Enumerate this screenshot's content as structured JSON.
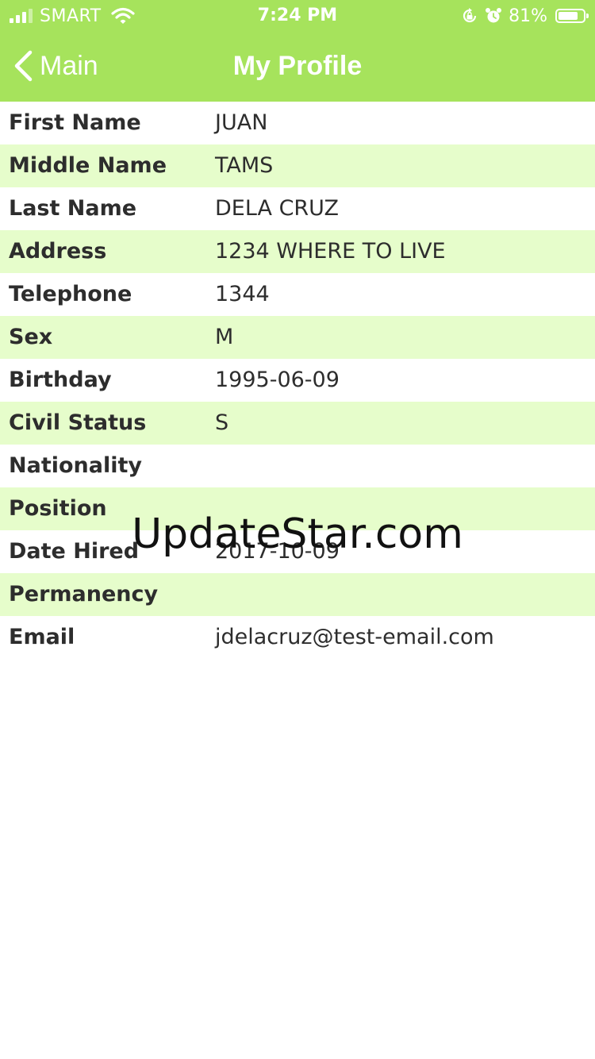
{
  "status_bar": {
    "carrier": "SMART",
    "time": "7:24 PM",
    "battery_percent": "81%",
    "battery_level": 0.81,
    "signal_bars_active": 3,
    "signal_bars_total": 4,
    "icons": [
      "signal-icon",
      "wifi-icon",
      "orientation-lock-icon",
      "alarm-icon",
      "battery-icon"
    ]
  },
  "nav": {
    "back_label": "Main",
    "title": "My Profile",
    "back_icon": "chevron-left-icon"
  },
  "colors": {
    "header": "#a6e35c",
    "row_alt": "#e6fdcb",
    "text": "#2d2d2d"
  },
  "profile": {
    "rows": [
      {
        "label": "First Name",
        "value": "JUAN"
      },
      {
        "label": "Middle Name",
        "value": "TAMS"
      },
      {
        "label": "Last Name",
        "value": "DELA CRUZ"
      },
      {
        "label": "Address",
        "value": "1234 WHERE TO LIVE"
      },
      {
        "label": "Telephone",
        "value": "1344"
      },
      {
        "label": "Sex",
        "value": "M"
      },
      {
        "label": "Birthday",
        "value": "1995-06-09"
      },
      {
        "label": "Civil Status",
        "value": "S"
      },
      {
        "label": "Nationality",
        "value": ""
      },
      {
        "label": "Position",
        "value": ""
      },
      {
        "label": "Date Hired",
        "value": "2017-10-09"
      },
      {
        "label": "Permanency",
        "value": ""
      },
      {
        "label": "Email",
        "value": "jdelacruz@test-email.com"
      }
    ]
  },
  "watermark": "UpdateStar.com"
}
